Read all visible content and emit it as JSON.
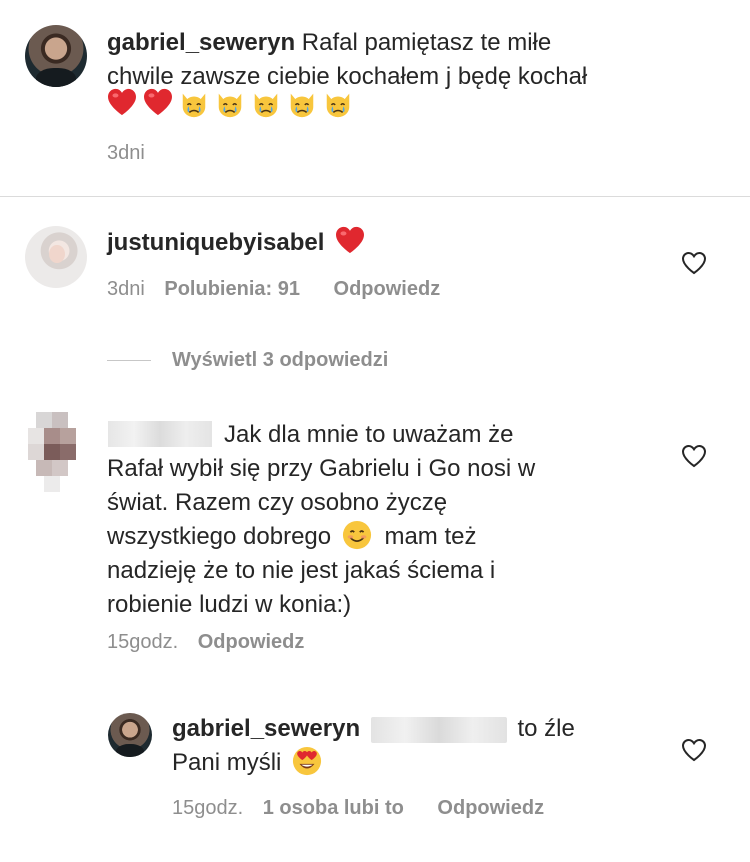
{
  "comments": [
    {
      "username": "gabriel_seweryn",
      "text_line1": "Rafal pamiętasz  te miłe",
      "text_line2": "chwile zawsze ciebie kochałem j będę kochał",
      "emojis": [
        "red-heart",
        "red-heart",
        "crying-cat",
        "crying-cat",
        "crying-cat",
        "crying-cat",
        "crying-cat"
      ],
      "time": "3dni"
    },
    {
      "username": "justuniquebyisabel",
      "emoji": "red-heart",
      "time": "3dni",
      "likes": "Polubienia: 91",
      "reply": "Odpowiedz",
      "view_replies": "Wyświetl 3 odpowiedzi"
    },
    {
      "username": "",
      "text_lines": [
        "Jak dla mnie to uważam że",
        "Rafał wybił się przy Gabrielu i Go nosi w",
        "świat. Razem czy osobno życzę",
        "wszystkiego dobrego",
        "mam też",
        "nadzieję że to nie jest jakaś ściema i",
        "robienie ludzi w konia:)"
      ],
      "time": "15godz.",
      "reply": "Odpowiedz"
    },
    {
      "username": "gabriel_seweryn",
      "text_after_mention": "to źle",
      "text_line2": "Pani myśli",
      "time": "15godz.",
      "likes": "1 osoba lubi to",
      "reply": "Odpowiedz"
    }
  ],
  "icons": {
    "like": "heart-outline-icon",
    "smile": "smiling-face-emoji",
    "heart_eyes": "heart-eyes-emoji"
  },
  "colors": {
    "text": "#262626",
    "meta": "#8e8e8e",
    "heart": "#e0282f",
    "divider": "#dbdbdb"
  }
}
